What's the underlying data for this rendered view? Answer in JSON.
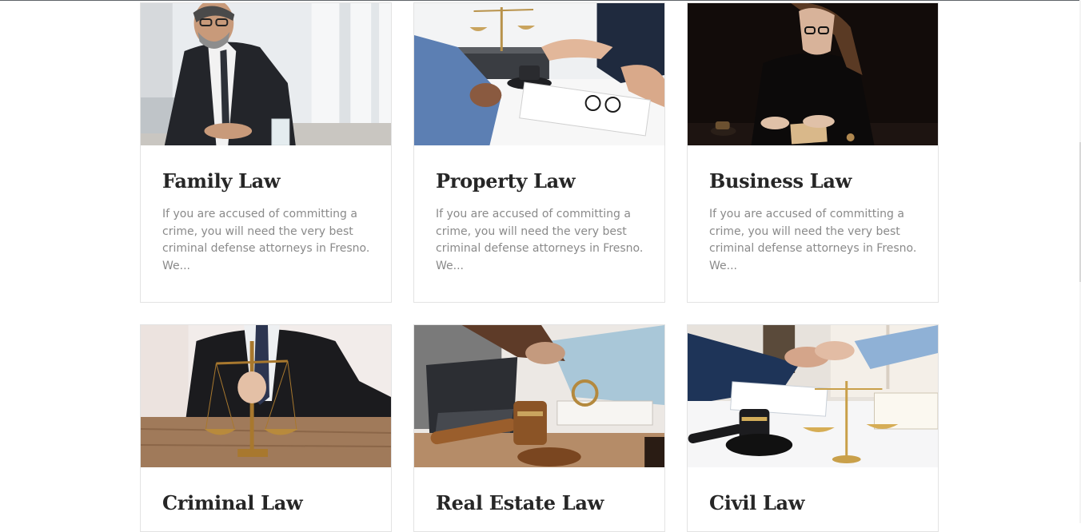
{
  "services": [
    {
      "title": "Family Law",
      "excerpt": "If you are accused of committing a crime, you will need the very best criminal defense attorneys in Fresno. We...",
      "image_icon": "lawyer-portrait-image"
    },
    {
      "title": "Property Law",
      "excerpt": "If you are accused of committing a crime, you will need the very best criminal defense attorneys in Fresno. We...",
      "image_icon": "scales-gavel-meeting-image"
    },
    {
      "title": "Business Law",
      "excerpt": "If you are accused of committing a crime, you will need the very best criminal defense attorneys in Fresno. We...",
      "image_icon": "attorney-at-desk-image"
    },
    {
      "title": "Criminal Law",
      "excerpt": "",
      "image_icon": "scales-of-justice-image"
    },
    {
      "title": "Real Estate Law",
      "excerpt": "",
      "image_icon": "gavel-handshake-image"
    },
    {
      "title": "Civil Law",
      "excerpt": "",
      "image_icon": "handshake-contract-image"
    }
  ]
}
